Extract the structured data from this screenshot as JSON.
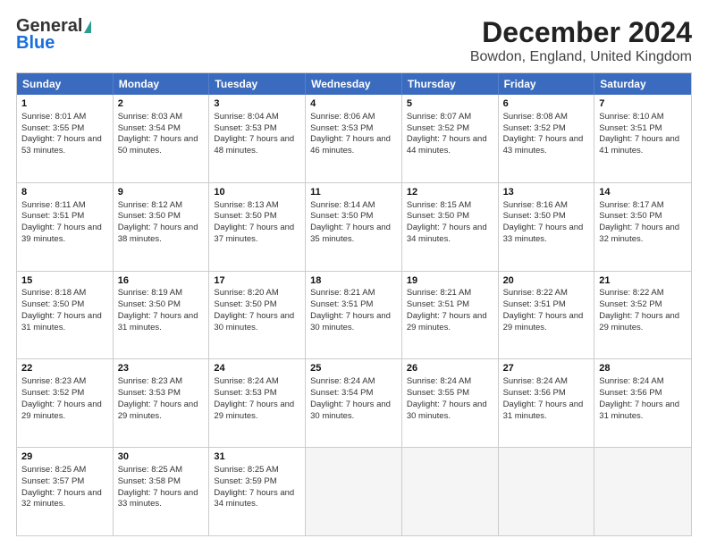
{
  "logo": {
    "line1": "General",
    "line2": "Blue"
  },
  "title": "December 2024",
  "subtitle": "Bowdon, England, United Kingdom",
  "days": [
    "Sunday",
    "Monday",
    "Tuesday",
    "Wednesday",
    "Thursday",
    "Friday",
    "Saturday"
  ],
  "weeks": [
    [
      {
        "day": 1,
        "sunrise": "8:01 AM",
        "sunset": "3:55 PM",
        "daylight": "7 hours and 53 minutes."
      },
      {
        "day": 2,
        "sunrise": "8:03 AM",
        "sunset": "3:54 PM",
        "daylight": "7 hours and 50 minutes."
      },
      {
        "day": 3,
        "sunrise": "8:04 AM",
        "sunset": "3:53 PM",
        "daylight": "7 hours and 48 minutes."
      },
      {
        "day": 4,
        "sunrise": "8:06 AM",
        "sunset": "3:53 PM",
        "daylight": "7 hours and 46 minutes."
      },
      {
        "day": 5,
        "sunrise": "8:07 AM",
        "sunset": "3:52 PM",
        "daylight": "7 hours and 44 minutes."
      },
      {
        "day": 6,
        "sunrise": "8:08 AM",
        "sunset": "3:52 PM",
        "daylight": "7 hours and 43 minutes."
      },
      {
        "day": 7,
        "sunrise": "8:10 AM",
        "sunset": "3:51 PM",
        "daylight": "7 hours and 41 minutes."
      }
    ],
    [
      {
        "day": 8,
        "sunrise": "8:11 AM",
        "sunset": "3:51 PM",
        "daylight": "7 hours and 39 minutes."
      },
      {
        "day": 9,
        "sunrise": "8:12 AM",
        "sunset": "3:50 PM",
        "daylight": "7 hours and 38 minutes."
      },
      {
        "day": 10,
        "sunrise": "8:13 AM",
        "sunset": "3:50 PM",
        "daylight": "7 hours and 37 minutes."
      },
      {
        "day": 11,
        "sunrise": "8:14 AM",
        "sunset": "3:50 PM",
        "daylight": "7 hours and 35 minutes."
      },
      {
        "day": 12,
        "sunrise": "8:15 AM",
        "sunset": "3:50 PM",
        "daylight": "7 hours and 34 minutes."
      },
      {
        "day": 13,
        "sunrise": "8:16 AM",
        "sunset": "3:50 PM",
        "daylight": "7 hours and 33 minutes."
      },
      {
        "day": 14,
        "sunrise": "8:17 AM",
        "sunset": "3:50 PM",
        "daylight": "7 hours and 32 minutes."
      }
    ],
    [
      {
        "day": 15,
        "sunrise": "8:18 AM",
        "sunset": "3:50 PM",
        "daylight": "7 hours and 31 minutes."
      },
      {
        "day": 16,
        "sunrise": "8:19 AM",
        "sunset": "3:50 PM",
        "daylight": "7 hours and 31 minutes."
      },
      {
        "day": 17,
        "sunrise": "8:20 AM",
        "sunset": "3:50 PM",
        "daylight": "7 hours and 30 minutes."
      },
      {
        "day": 18,
        "sunrise": "8:21 AM",
        "sunset": "3:51 PM",
        "daylight": "7 hours and 30 minutes."
      },
      {
        "day": 19,
        "sunrise": "8:21 AM",
        "sunset": "3:51 PM",
        "daylight": "7 hours and 29 minutes."
      },
      {
        "day": 20,
        "sunrise": "8:22 AM",
        "sunset": "3:51 PM",
        "daylight": "7 hours and 29 minutes."
      },
      {
        "day": 21,
        "sunrise": "8:22 AM",
        "sunset": "3:52 PM",
        "daylight": "7 hours and 29 minutes."
      }
    ],
    [
      {
        "day": 22,
        "sunrise": "8:23 AM",
        "sunset": "3:52 PM",
        "daylight": "7 hours and 29 minutes."
      },
      {
        "day": 23,
        "sunrise": "8:23 AM",
        "sunset": "3:53 PM",
        "daylight": "7 hours and 29 minutes."
      },
      {
        "day": 24,
        "sunrise": "8:24 AM",
        "sunset": "3:53 PM",
        "daylight": "7 hours and 29 minutes."
      },
      {
        "day": 25,
        "sunrise": "8:24 AM",
        "sunset": "3:54 PM",
        "daylight": "7 hours and 30 minutes."
      },
      {
        "day": 26,
        "sunrise": "8:24 AM",
        "sunset": "3:55 PM",
        "daylight": "7 hours and 30 minutes."
      },
      {
        "day": 27,
        "sunrise": "8:24 AM",
        "sunset": "3:56 PM",
        "daylight": "7 hours and 31 minutes."
      },
      {
        "day": 28,
        "sunrise": "8:24 AM",
        "sunset": "3:56 PM",
        "daylight": "7 hours and 31 minutes."
      }
    ],
    [
      {
        "day": 29,
        "sunrise": "8:25 AM",
        "sunset": "3:57 PM",
        "daylight": "7 hours and 32 minutes."
      },
      {
        "day": 30,
        "sunrise": "8:25 AM",
        "sunset": "3:58 PM",
        "daylight": "7 hours and 33 minutes."
      },
      {
        "day": 31,
        "sunrise": "8:25 AM",
        "sunset": "3:59 PM",
        "daylight": "7 hours and 34 minutes."
      },
      null,
      null,
      null,
      null
    ]
  ]
}
